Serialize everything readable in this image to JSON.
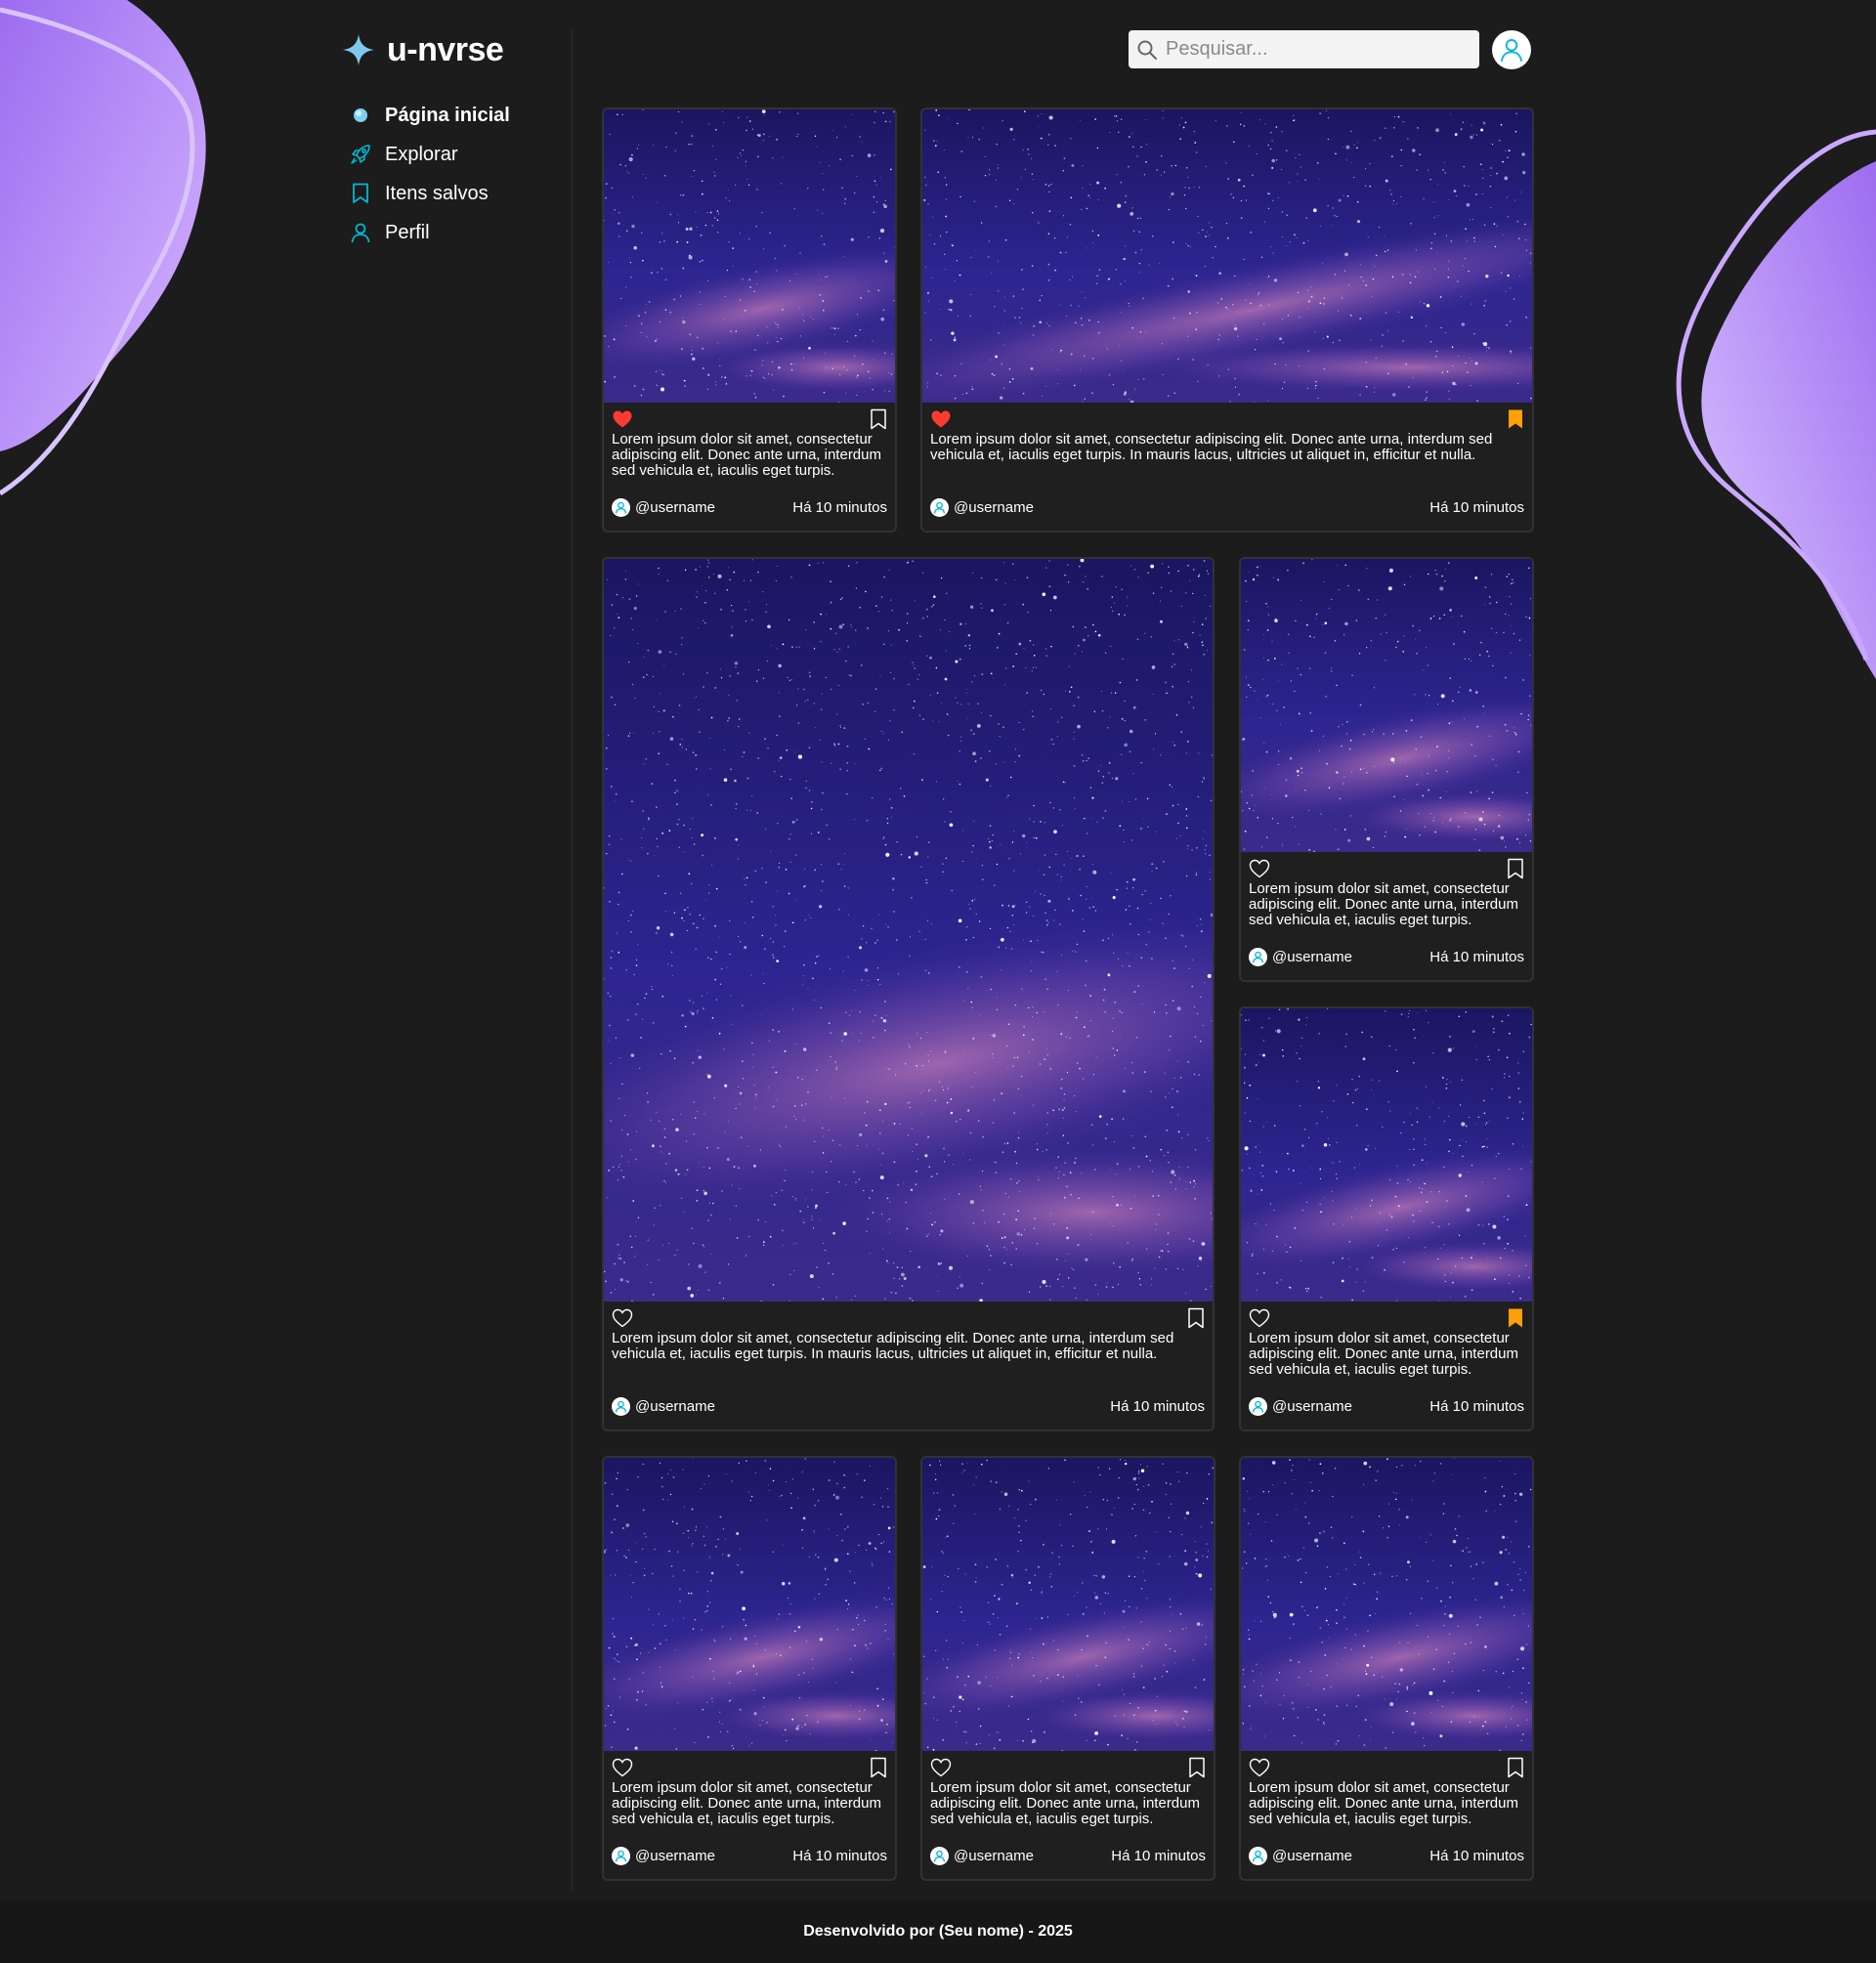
{
  "app": {
    "logo_text": "u-nvrse"
  },
  "sidebar": {
    "items": [
      {
        "label": "Página inicial",
        "icon": "planet-icon"
      },
      {
        "label": "Explorar",
        "icon": "rocket-icon"
      },
      {
        "label": "Itens salvos",
        "icon": "bookmark-icon"
      },
      {
        "label": "Perfil",
        "icon": "user-icon"
      }
    ]
  },
  "search": {
    "placeholder": "Pesquisar..."
  },
  "colors": {
    "accent": "#00b8d4",
    "like": "#ff3b30",
    "saved": "#ff9f0a",
    "blob": "#b784ff"
  },
  "posts": [
    {
      "liked": true,
      "saved": false,
      "caption": "Lorem ipsum dolor sit amet, consectetur adipiscing elit. Donec ante urna, interdum sed vehicula et, iaculis eget turpis.",
      "username": "@username",
      "time": "Há 10 minutos"
    },
    {
      "liked": true,
      "saved": true,
      "caption": "Lorem ipsum dolor sit amet, consectetur adipiscing elit. Donec ante urna, interdum sed vehicula et, iaculis eget turpis. In mauris lacus, ultricies ut aliquet in, efficitur et nulla.",
      "username": "@username",
      "time": "Há 10 minutos"
    },
    {
      "liked": false,
      "saved": false,
      "caption": "Lorem ipsum dolor sit amet, consectetur adipiscing elit. Donec ante urna, interdum sed vehicula et, iaculis eget turpis. In mauris lacus, ultricies ut aliquet in, efficitur et nulla.",
      "username": "@username",
      "time": "Há 10 minutos"
    },
    {
      "liked": false,
      "saved": false,
      "caption": "Lorem ipsum dolor sit amet, consectetur adipiscing elit. Donec ante urna, interdum sed vehicula et, iaculis eget turpis.",
      "username": "@username",
      "time": "Há 10 minutos"
    },
    {
      "liked": false,
      "saved": true,
      "caption": "Lorem ipsum dolor sit amet, consectetur adipiscing elit. Donec ante urna, interdum sed vehicula et, iaculis eget turpis.",
      "username": "@username",
      "time": "Há 10 minutos"
    },
    {
      "liked": false,
      "saved": false,
      "caption": "Lorem ipsum dolor sit amet, consectetur adipiscing elit. Donec ante urna, interdum sed vehicula et, iaculis eget turpis.",
      "username": "@username",
      "time": "Há 10 minutos"
    },
    {
      "liked": false,
      "saved": false,
      "caption": "Lorem ipsum dolor sit amet, consectetur adipiscing elit. Donec ante urna, interdum sed vehicula et, iaculis eget turpis.",
      "username": "@username",
      "time": "Há 10 minutos"
    },
    {
      "liked": false,
      "saved": false,
      "caption": "Lorem ipsum dolor sit amet, consectetur adipiscing elit. Donec ante urna, interdum sed vehicula et, iaculis eget turpis.",
      "username": "@username",
      "time": "Há 10 minutos"
    }
  ],
  "footer": {
    "text": "Desenvolvido por (Seu nome) - 2025"
  }
}
